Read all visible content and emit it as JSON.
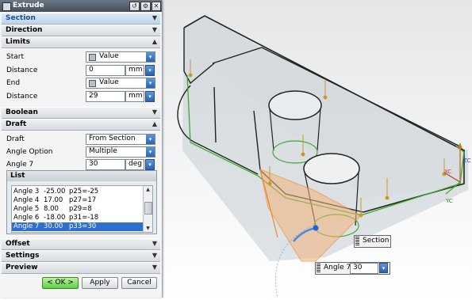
{
  "dialog": {
    "title": "Extrude",
    "title_buttons": [
      "reset",
      "settings",
      "close"
    ],
    "sections": {
      "section": "Section",
      "direction": "Direction",
      "limits": "Limits",
      "boolean": "Boolean",
      "draft": "Draft",
      "offset": "Offset",
      "settings": "Settings",
      "preview": "Preview"
    },
    "limits": {
      "start_label": "Start",
      "start_value": "Value",
      "start_distance_label": "Distance",
      "start_distance": "0",
      "start_unit": "mm",
      "end_label": "End",
      "end_value": "Value",
      "end_distance_label": "Distance",
      "end_distance": "29",
      "end_unit": "mm"
    },
    "draft": {
      "draft_label": "Draft",
      "draft_value": "From Section",
      "angle_option_label": "Angle Option",
      "angle_option_value": "Multiple",
      "angle_label": "Angle 7",
      "angle_value": "30",
      "angle_unit": "deg",
      "list_title": "List",
      "list_rows": [
        {
          "name": "Angle 3",
          "value": "-25.00",
          "expr": "p25=-25"
        },
        {
          "name": "Angle 4",
          "value": "17.00",
          "expr": "p27=17"
        },
        {
          "name": "Angle 5",
          "value": "8.00",
          "expr": "p29=8"
        },
        {
          "name": "Angle 6",
          "value": "-18.00",
          "expr": "p31=-18"
        },
        {
          "name": "Angle 7",
          "value": "30.00",
          "expr": "p33=30"
        }
      ],
      "selected_row": 4
    },
    "buttons": {
      "ok": "< OK >",
      "apply": "Apply",
      "cancel": "Cancel"
    }
  },
  "viewport": {
    "section_tag": "Section",
    "angle_tag_label": "Angle 7",
    "angle_tag_value": "30",
    "axis_labels": {
      "xc": "XC",
      "yc": "YC",
      "zc": "ZC"
    }
  },
  "colors": {
    "draft_face": "#f2b27a",
    "draft_edge": "#e8892a",
    "green_edges": "#3ea82e",
    "body_fill": "#bcc3ca",
    "accent_blue": "#2f6fd0"
  }
}
